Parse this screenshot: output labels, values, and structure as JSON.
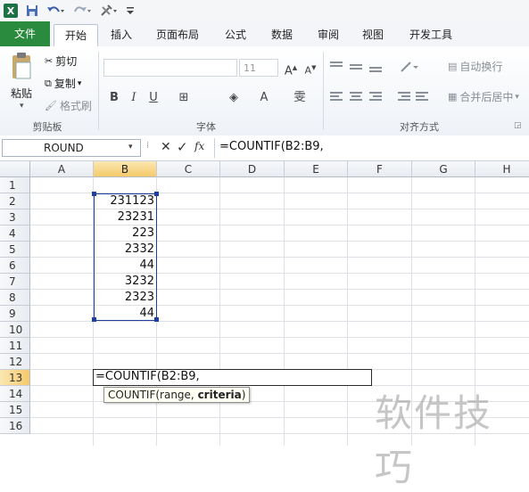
{
  "quick_access": {
    "excel_icon": "X",
    "save_icon": "save-icon",
    "undo_icon": "undo-icon",
    "redo_icon": "redo-icon",
    "tools_icon": "tools-icon",
    "more_icon": "menu-icon"
  },
  "tabs": [
    {
      "label": "文件"
    },
    {
      "label": "开始"
    },
    {
      "label": "插入"
    },
    {
      "label": "页面布局"
    },
    {
      "label": "公式"
    },
    {
      "label": "数据"
    },
    {
      "label": "审阅"
    },
    {
      "label": "视图"
    },
    {
      "label": "开发工具"
    }
  ],
  "ribbon": {
    "clipboard": {
      "paste": "粘贴",
      "cut": "剪切",
      "copy": "复制",
      "format_painter": "格式刷",
      "group": "剪贴板"
    },
    "font": {
      "size": "11",
      "group": "字体",
      "grow": "A",
      "shrink": "A",
      "bold": "B",
      "italic": "I",
      "underline": "U",
      "border": "⊞",
      "fill": "◈",
      "color": "A",
      "phonetic": "雯"
    },
    "alignment": {
      "wrap": "自动换行",
      "merge": "合并后居中",
      "group": "对齐方式"
    }
  },
  "formula_bar": {
    "name_box": "ROUND",
    "cancel": "✕",
    "enter": "✓",
    "fx": "fx",
    "formula": "=COUNTIF(B2:B9,"
  },
  "columns": [
    "A",
    "B",
    "C",
    "D",
    "E",
    "F",
    "G",
    "H"
  ],
  "rows": [
    "1",
    "2",
    "3",
    "4",
    "5",
    "6",
    "7",
    "8",
    "9",
    "10",
    "11",
    "12",
    "13",
    "14",
    "15",
    "16"
  ],
  "cells_B": [
    "",
    "231123",
    "23231",
    "223",
    "2332",
    "44",
    "3232",
    "2323",
    "44"
  ],
  "edit_cell": {
    "text": "=COUNTIF(B2:B9,"
  },
  "tooltip": {
    "func": "COUNTIF(range, ",
    "arg": "criteria",
    "close": ")"
  },
  "watermark": "软件技巧",
  "colors": {
    "accent": "#2a8a3e",
    "range": "#1f3fa0",
    "selected_header": "#f5c96a"
  }
}
